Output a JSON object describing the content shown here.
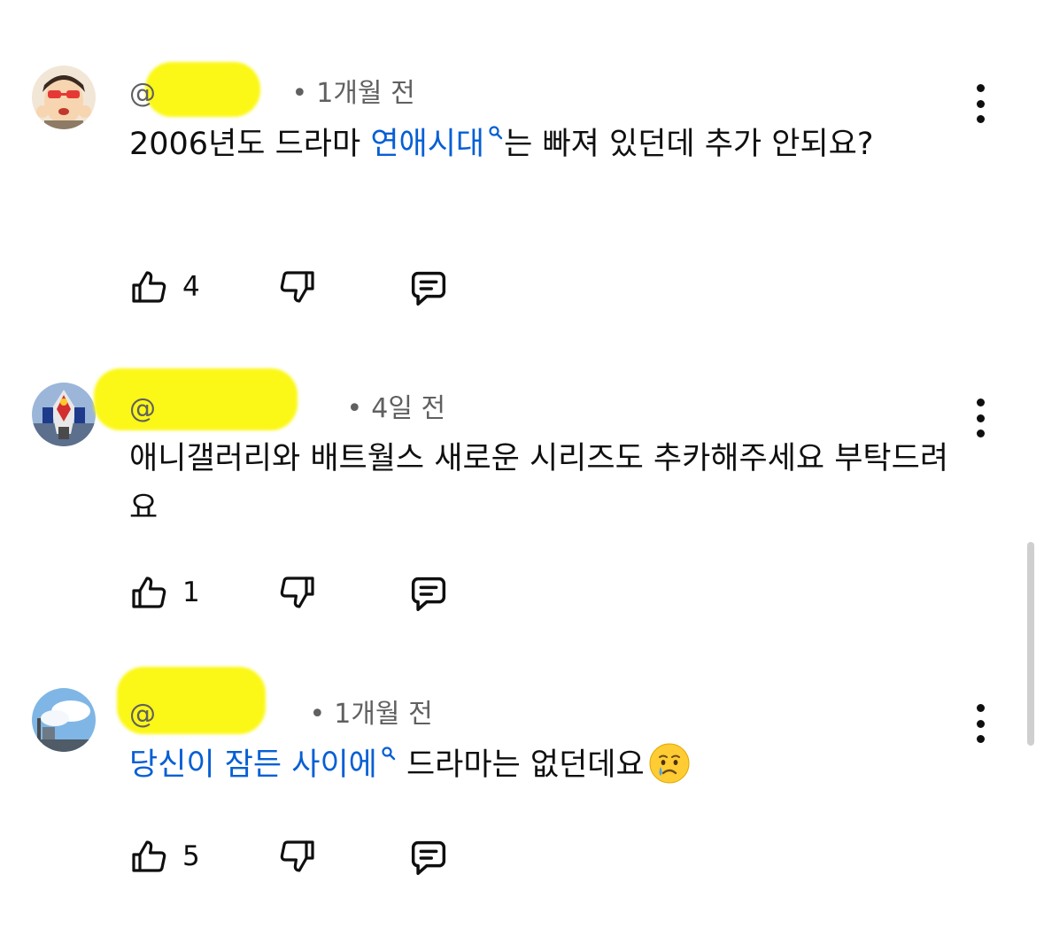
{
  "comments": [
    {
      "handle": "@",
      "time": "1개월 전",
      "text_before": "2006년도 드라마 ",
      "link_text": "연애시대",
      "text_after": "는 빠져 있던데 추가 안되요?",
      "likes": "4"
    },
    {
      "handle": "@",
      "time": "4일 전",
      "text": "애니갤러리와 배트월스 새로운 시리즈도 추카해주세요 부탁드려요",
      "likes": "1"
    },
    {
      "handle": "@",
      "time": "1개월 전",
      "link_text": "당신이 잠든 사이에",
      "text_after": " 드라마는 없던데요",
      "emoji": "crying-face",
      "likes": "5"
    }
  ],
  "icons": [
    "like-icon",
    "dislike-icon",
    "reply-icon",
    "more-vert-icon",
    "search-icon"
  ],
  "colors": {
    "link": "#065fd4",
    "meta": "#606060",
    "redaction": "#fbf70a"
  }
}
